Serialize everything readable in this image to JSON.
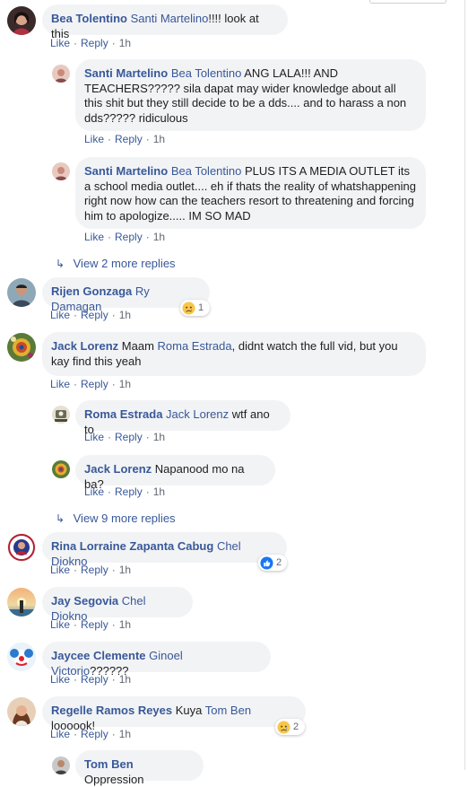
{
  "actions": {
    "like": "Like",
    "reply": "Reply",
    "dot": "·"
  },
  "colors": {
    "link": "#385898",
    "bubble": "#f2f3f5",
    "meta": "#616770"
  },
  "comments": [
    {
      "author": "Bea Tolentino",
      "mention": "Santi Martelino",
      "text": "!!!! look at this",
      "time": "1h",
      "avatar_icon": "profile-avatar-dark-hair"
    },
    {
      "author": "Santi Martelino",
      "mention": "Bea Tolentino",
      "text": "ANG LALA!!! AND TEACHERS????? sila dapat may wider knowledge about all this shit but they still decide to be a dds.... and to harass a non dds????? ridiculous",
      "time": "1h",
      "avatar_icon": "profile-avatar-pink"
    },
    {
      "author": "Santi Martelino",
      "mention": "Bea Tolentino",
      "text": "PLUS ITS A MEDIA OUTLET its a school media outlet.... eh if thats the reality of whatshappening right now how can the teachers resort to threatening and forcing him to apologize..... IM SO MAD",
      "time": "1h",
      "avatar_icon": "profile-avatar-pink"
    },
    {
      "author": "Rijen Gonzaga",
      "mention": "Ry Damagan",
      "text": "",
      "time": "1h",
      "avatar_icon": "profile-avatar-man",
      "reaction": {
        "icon": "sad-emoji-icon",
        "count": "1"
      }
    },
    {
      "author": "Jack Lorenz",
      "mention": "",
      "pre": "Maam ",
      "mention2": "Roma Estrada",
      "text": ", didnt watch the full vid, but you kay find this yeah",
      "time": "1h",
      "avatar_icon": "profile-avatar-colorful"
    },
    {
      "author": "Roma Estrada",
      "mention": "Jack Lorenz",
      "text": "wtf ano to",
      "time": "1h",
      "avatar_icon": "profile-avatar-illustration"
    },
    {
      "author": "Jack Lorenz",
      "mention": "",
      "text": "Napanood mo na ba?",
      "time": "1h",
      "avatar_icon": "profile-avatar-colorful"
    },
    {
      "author": "Rina Lorraine Zapanta Cabug",
      "mention": "Chel Diokno",
      "text": "",
      "time": "1h",
      "avatar_icon": "profile-avatar-badge",
      "reaction": {
        "icon": "like-icon",
        "count": "2"
      }
    },
    {
      "author": "Jay Segovia",
      "mention": "Chel Diokno",
      "text": "",
      "time": "1h",
      "avatar_icon": "profile-avatar-sunset"
    },
    {
      "author": "Jaycee Clemente",
      "mention": "Ginoel Victorio",
      "text": "??????",
      "time": "1h",
      "avatar_icon": "profile-avatar-clown"
    },
    {
      "author": "Regelle Ramos Reyes",
      "mention": "",
      "pre": "Kuya ",
      "mention2": "Tom Ben",
      "text": " loooook!",
      "time": "1h",
      "avatar_icon": "profile-avatar-woman",
      "reaction": {
        "icon": "sad-emoji-icon",
        "count": "2"
      }
    },
    {
      "author": "Tom Ben",
      "mention": "",
      "text": "Oppression",
      "time": "",
      "avatar_icon": "profile-avatar-man2"
    }
  ],
  "more_replies": [
    {
      "label": "View 2 more replies"
    },
    {
      "label": "View 9 more replies"
    }
  ]
}
